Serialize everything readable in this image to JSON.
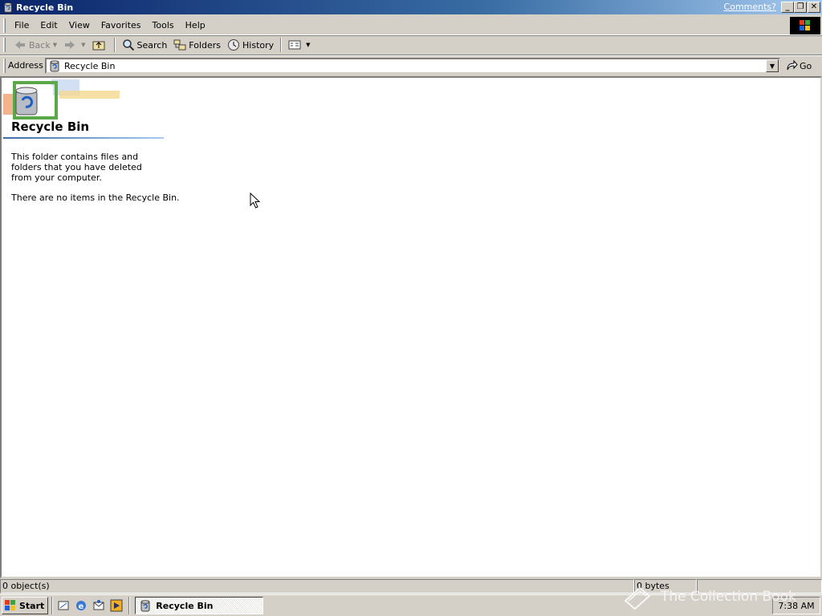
{
  "window": {
    "title": "Recycle Bin",
    "comments_link": "Comments?",
    "minimize_label": "_",
    "restore_label": "❐",
    "close_label": "✕"
  },
  "menu": {
    "items": [
      "File",
      "Edit",
      "View",
      "Favorites",
      "Tools",
      "Help"
    ]
  },
  "toolbar": {
    "back_label": "Back",
    "search_label": "Search",
    "folders_label": "Folders",
    "history_label": "History"
  },
  "address": {
    "label": "Address",
    "value": "Recycle Bin",
    "go_label": "Go"
  },
  "folder": {
    "title": "Recycle Bin",
    "description": "This folder contains files and folders that you have deleted from your computer.",
    "empty_note": "There are no items in the Recycle Bin."
  },
  "statusbar": {
    "objects": "0 object(s)",
    "size": "0 bytes"
  },
  "taskbar": {
    "start_label": "Start",
    "task_label": "Recycle Bin",
    "clock": "7:38 AM"
  },
  "watermark": {
    "text": "The Collection Book"
  },
  "colors": {
    "title_gradient_start": "#0a246a",
    "title_gradient_end": "#a6caf0",
    "chrome": "#d4d0c8"
  }
}
